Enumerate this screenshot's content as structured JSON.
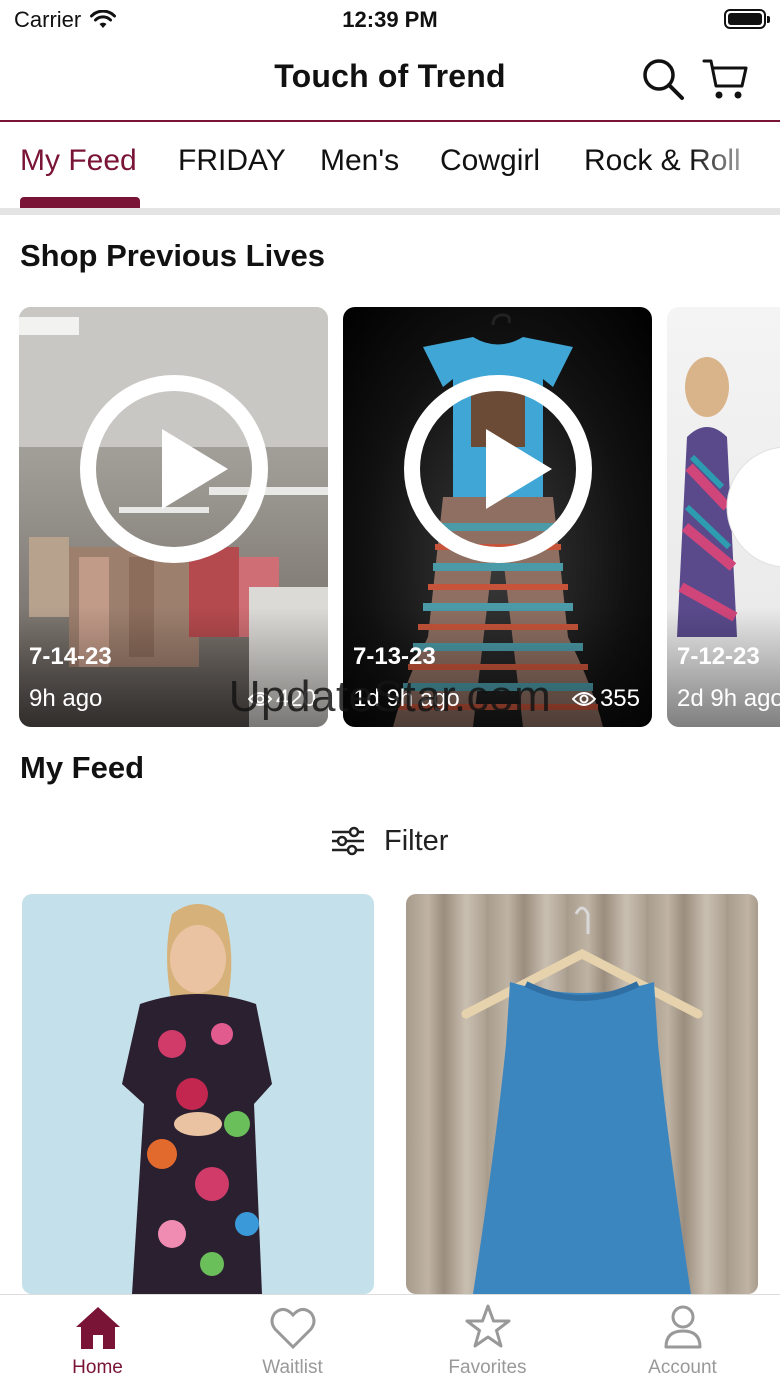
{
  "status_bar": {
    "carrier": "Carrier",
    "time": "12:39 PM"
  },
  "header": {
    "title": "Touch of Trend",
    "search_icon": "search-icon",
    "cart_icon": "cart-icon"
  },
  "tabs": [
    {
      "label": "My Feed",
      "active": true
    },
    {
      "label": "FRIDAY",
      "active": false
    },
    {
      "label": "Men's",
      "active": false
    },
    {
      "label": "Cowgirl",
      "active": false
    },
    {
      "label": "Rock & Roll",
      "active": false
    }
  ],
  "lives": {
    "title": "Shop Previous Lives",
    "cards": [
      {
        "date": "7-14-23",
        "ago": "9h ago",
        "views": "420"
      },
      {
        "date": "7-13-23",
        "ago": "1d 9h ago",
        "views": "355"
      },
      {
        "date": "7-12-23",
        "ago": "2d 9h ago",
        "views": ""
      }
    ]
  },
  "watermark": "UpdateStar.com",
  "feed": {
    "title": "My Feed",
    "filter_label": "Filter"
  },
  "tab_bar": [
    {
      "label": "Home",
      "icon": "home-icon",
      "active": true
    },
    {
      "label": "Waitlist",
      "icon": "heart-icon",
      "active": false
    },
    {
      "label": "Favorites",
      "icon": "star-icon",
      "active": false
    },
    {
      "label": "Account",
      "icon": "person-icon",
      "active": false
    }
  ],
  "colors": {
    "accent": "#7a1437",
    "inactive": "#999999"
  }
}
